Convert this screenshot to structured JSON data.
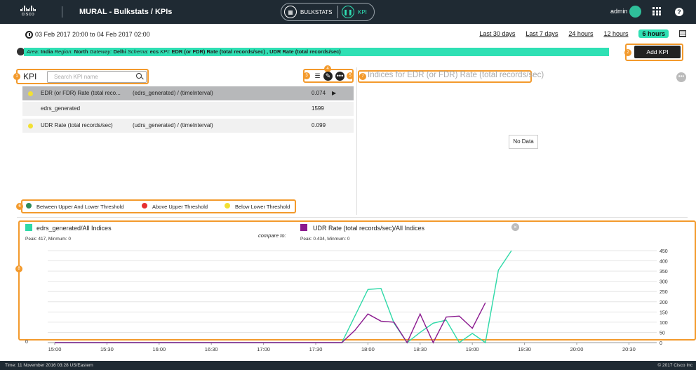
{
  "header": {
    "logo_text": "cisco",
    "app_title": "MURAL - Bulkstats / KPIs",
    "toggle": {
      "bulkstats_label": "BULKSTATS",
      "kpi_label": "KPI"
    },
    "user": "admin"
  },
  "daterange": {
    "text": "03 Feb 2017 20:00 to 04 Feb 2017 02:00",
    "options": [
      "Last 30 days",
      "Last 7 days",
      "24 hours",
      "12 hours",
      "6 hours"
    ],
    "active": "6 hours"
  },
  "filter": {
    "area_label": "Area:",
    "area_value": "India",
    "region_label": "Region:",
    "region_value": "North",
    "gateway_label": "Gateway:",
    "gateway_value": "Delhi",
    "schema_label": "Schema:",
    "schema_value": "ecs",
    "kpi_label": "KPI:",
    "kpi_value": "EDR (or FDR) Rate (total records/sec) , UDR Rate (total records/sec)"
  },
  "add_kpi_label": "Add KPI",
  "markers": [
    "1",
    "2",
    "3",
    "4",
    "5",
    "6",
    "7",
    "8"
  ],
  "kpi_panel": {
    "title": "KPI",
    "search_placeholder": "Search KPI name",
    "rows": [
      {
        "name": "EDR (or FDR) Rate (total reco...",
        "formula": "(edrs_generated) / (timeInterval)",
        "value": "0.074",
        "arrow": "▶",
        "selected": true,
        "dot": true
      },
      {
        "name": "edrs_generated",
        "formula": "",
        "value": "1599",
        "selected": false,
        "dot": false
      },
      {
        "name": "UDR Rate (total records/sec)",
        "formula": "(udrs_generated) / (timeInterval)",
        "value": "0.099",
        "selected": false,
        "dot": true
      }
    ]
  },
  "right_panel": {
    "title": "Indices for EDR (or FDR) Rate (total records/sec)",
    "no_data": "No Data"
  },
  "legend": {
    "items": [
      {
        "label": "Between Upper And Lower Threshold",
        "color": "#2f8a5a"
      },
      {
        "label": "Above Upper Threshold",
        "color": "#e63030"
      },
      {
        "label": "Below Lower Threshold",
        "color": "#f2e033"
      }
    ]
  },
  "compare": {
    "left_name": "edrs_generated/All Indices",
    "left_peak": "Peak: 417, Minmum: 0",
    "left_color": "#2fd9a8",
    "compare_label": "compare to:",
    "right_name": "UDR Rate (total records/sec)/All Indices",
    "right_peak": "Peak: 0.434, Minmum: 0",
    "right_color": "#8b1a8f"
  },
  "chart_data": {
    "type": "line",
    "x": [
      "15:00",
      "15:30",
      "16:00",
      "16:30",
      "17:00",
      "17:30",
      "18:00",
      "18:30",
      "19:00",
      "19:30",
      "20:00",
      "20:30"
    ],
    "left_axis_label": "0",
    "right_ticks": [
      0,
      50,
      100,
      150,
      200,
      250,
      300,
      350,
      400,
      450
    ],
    "ylim": [
      0,
      450
    ],
    "series": [
      {
        "name": "edrs_generated/All Indices",
        "color": "#2fd9a8",
        "points": [
          [
            0,
            0
          ],
          [
            1,
            0
          ],
          [
            2,
            0
          ],
          [
            3,
            0
          ],
          [
            4,
            0
          ],
          [
            5,
            0
          ],
          [
            5.5,
            0
          ],
          [
            6,
            260
          ],
          [
            6.25,
            265
          ],
          [
            6.5,
            95
          ],
          [
            6.75,
            0
          ],
          [
            7,
            50
          ],
          [
            7.25,
            95
          ],
          [
            7.5,
            110
          ],
          [
            7.75,
            0
          ],
          [
            8,
            45
          ],
          [
            8.25,
            0
          ],
          [
            8.5,
            355
          ],
          [
            8.75,
            450
          ]
        ]
      },
      {
        "name": "UDR Rate (total records/sec)/All Indices",
        "color": "#8b1a8f",
        "points": [
          [
            0,
            0
          ],
          [
            1,
            0
          ],
          [
            2,
            0
          ],
          [
            3,
            0
          ],
          [
            4,
            0
          ],
          [
            5,
            0
          ],
          [
            5.5,
            0
          ],
          [
            5.75,
            60
          ],
          [
            6,
            140
          ],
          [
            6.25,
            105
          ],
          [
            6.5,
            100
          ],
          [
            6.75,
            0
          ],
          [
            7,
            140
          ],
          [
            7.25,
            0
          ],
          [
            7.5,
            125
          ],
          [
            7.75,
            130
          ],
          [
            8,
            70
          ],
          [
            8.25,
            195
          ]
        ]
      }
    ]
  },
  "footer": {
    "time": "Time: 11 November 2016 03:28 US/Eastern",
    "copyright": "© 2017 Cisco Inc"
  }
}
